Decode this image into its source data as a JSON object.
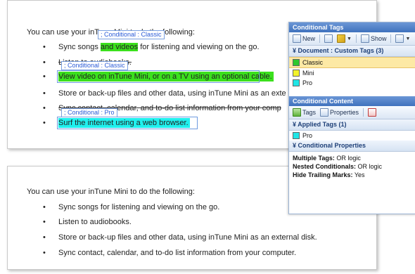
{
  "doc_top": {
    "intro": "You can use your inTune Mini to do the following:",
    "bullets": [
      {
        "pre": "Sync songs ",
        "hl": "and videos",
        "post": " for listening and viewing on the go."
      },
      {
        "text": "Listen to audiobooks."
      },
      {
        "text": "View video on inTune Mini, or on a TV using an optional cable."
      },
      {
        "text": "Store or back-up files and other data, using inTune Mini as an exte"
      },
      {
        "text": "Sync contact, calendar, and to-do list information from your comp"
      },
      {
        "text": "Surf the internet using a web browser."
      }
    ],
    "tags": [
      "; Conditional : Classic",
      "; Conditional : Classic",
      "; Conditional : Pro"
    ]
  },
  "doc_bottom": {
    "intro": "You can use your inTune Mini to do the following:",
    "bullets": [
      "Sync songs for listening and viewing on the go.",
      "Listen to audiobooks.",
      "Store or back-up files and other data, using inTune Mini as an external disk.",
      "Sync contact, calendar, and to-do list information from your computer."
    ]
  },
  "panel": {
    "title_tags": "Conditional Tags",
    "toolbar1": {
      "new": "New",
      "show": "Show"
    },
    "section_doc": "Document : Custom Tags (3)",
    "tags": [
      {
        "name": "Classic",
        "color": "#2ec82e"
      },
      {
        "name": "Mini",
        "color": "#f2f22a"
      },
      {
        "name": "Pro",
        "color": "#20e6e6"
      }
    ],
    "title_content": "Conditional Content",
    "toolbar2": {
      "tags": "Tags",
      "properties": "Properties"
    },
    "section_applied": "Applied Tags (1)",
    "applied": [
      {
        "name": "Pro",
        "color": "#20e6e6"
      }
    ],
    "section_props": "Conditional Properties",
    "props": [
      {
        "k": "Multiple Tags:",
        "v": "OR logic"
      },
      {
        "k": "Nested Conditionals:",
        "v": "OR logic"
      },
      {
        "k": "Hide Trailing Marks:",
        "v": "Yes"
      }
    ]
  }
}
